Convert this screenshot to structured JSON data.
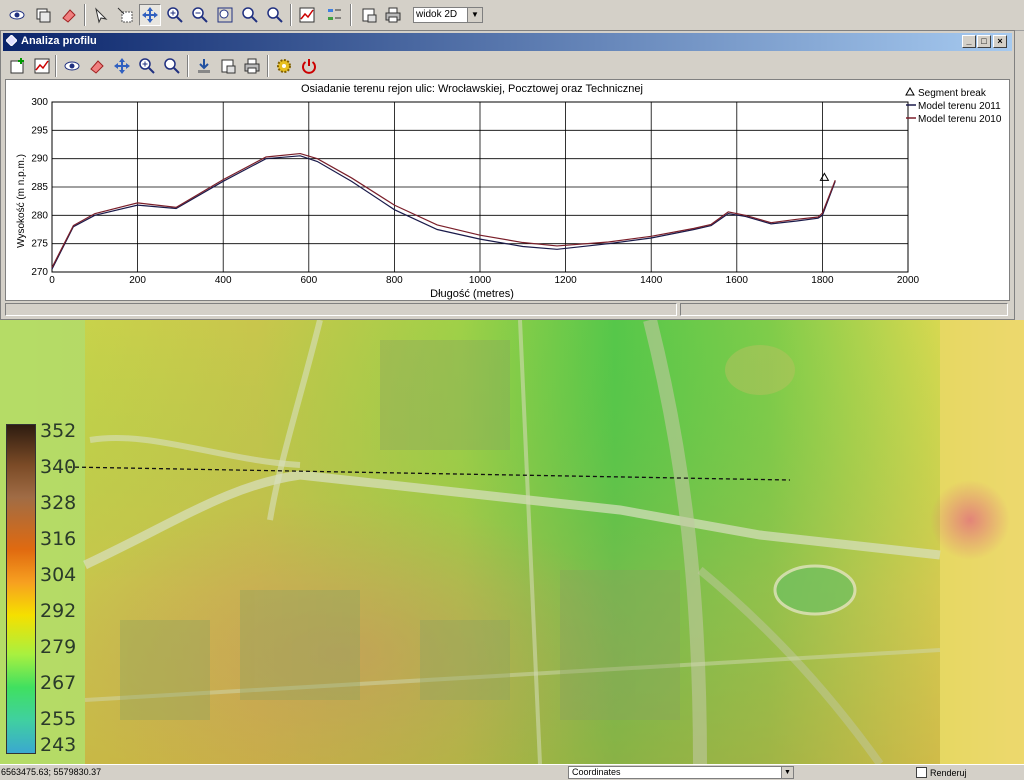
{
  "toolbar": {
    "buttons": [
      "eye-icon",
      "layers-icon",
      "eraser-icon",
      "arrow-icon",
      "select-tool-icon",
      "pan-icon",
      "zoom-in-icon",
      "zoom-out-icon",
      "zoom-extent-icon",
      "zoom-previous-icon",
      "zoom-next-icon",
      "profile-chart-icon",
      "legend-icon",
      "layer-export-icon",
      "print-icon"
    ],
    "view_select": "widok 2D"
  },
  "window": {
    "title": "Analiza profilu",
    "buttons": [
      "_",
      "□",
      "×"
    ]
  },
  "window_toolbar": {
    "buttons": [
      "add-profile-icon",
      "chart-icon",
      "eye-icon",
      "eraser-icon",
      "pan-icon",
      "zoom-in-icon",
      "zoom-full-icon",
      "download-icon",
      "export-icon",
      "print-icon",
      "settings-icon",
      "power-icon"
    ]
  },
  "chart_data": {
    "type": "line",
    "title": "Osiadanie terenu rejon ulic: Wrocławskiej, Pocztowej oraz Technicznej",
    "xlabel": "Długość (metres)",
    "ylabel": "Wysokość (m n.p.m.)",
    "xlim": [
      0,
      2000
    ],
    "ylim": [
      270,
      300
    ],
    "xticks": [
      0,
      200,
      400,
      600,
      800,
      1000,
      1200,
      1400,
      1600,
      1800,
      2000
    ],
    "yticks": [
      270,
      275,
      280,
      285,
      290,
      295,
      300
    ],
    "grid": true,
    "legend_position": "right",
    "legend": [
      "Segment break",
      "Model terenu 2011",
      "Model terenu 2010"
    ],
    "segment_break": {
      "x": 1800,
      "y": 286
    },
    "series": [
      {
        "name": "Model terenu 2011",
        "color": "#1a1a4a",
        "x": [
          0,
          50,
          100,
          200,
          290,
          400,
          500,
          580,
          620,
          700,
          800,
          900,
          1000,
          1100,
          1180,
          1300,
          1400,
          1500,
          1540,
          1580,
          1620,
          1680,
          1740,
          1790,
          1800,
          1830
        ],
        "y": [
          270.5,
          278,
          280,
          281.8,
          281.2,
          286,
          290,
          290.5,
          289.5,
          286,
          281,
          277.5,
          275.8,
          274.5,
          274,
          275,
          276,
          277.5,
          278.2,
          280.3,
          279.8,
          278.5,
          279,
          279.5,
          280,
          286
        ]
      },
      {
        "name": "Model terenu 2010",
        "color": "#7a1f2a",
        "x": [
          0,
          50,
          100,
          200,
          290,
          400,
          500,
          580,
          620,
          700,
          800,
          900,
          1000,
          1100,
          1180,
          1300,
          1400,
          1500,
          1540,
          1580,
          1620,
          1680,
          1740,
          1790,
          1800,
          1830
        ],
        "y": [
          270.8,
          278.2,
          280.3,
          282.2,
          281.4,
          286.3,
          290.3,
          290.9,
          290,
          286.6,
          281.8,
          278.3,
          276.5,
          275.2,
          274.6,
          275.3,
          276.3,
          277.7,
          278.4,
          280.6,
          280,
          278.7,
          279.3,
          279.7,
          280.4,
          286.2
        ]
      }
    ]
  },
  "legend": {
    "values": [
      "352",
      "340",
      "328",
      "316",
      "304",
      "292",
      "279",
      "267",
      "255",
      "243"
    ]
  },
  "status": {
    "coordinates": "6563475.63; 5579830.37",
    "coord_select": "Coordinates",
    "render_label": "Renderuj"
  }
}
